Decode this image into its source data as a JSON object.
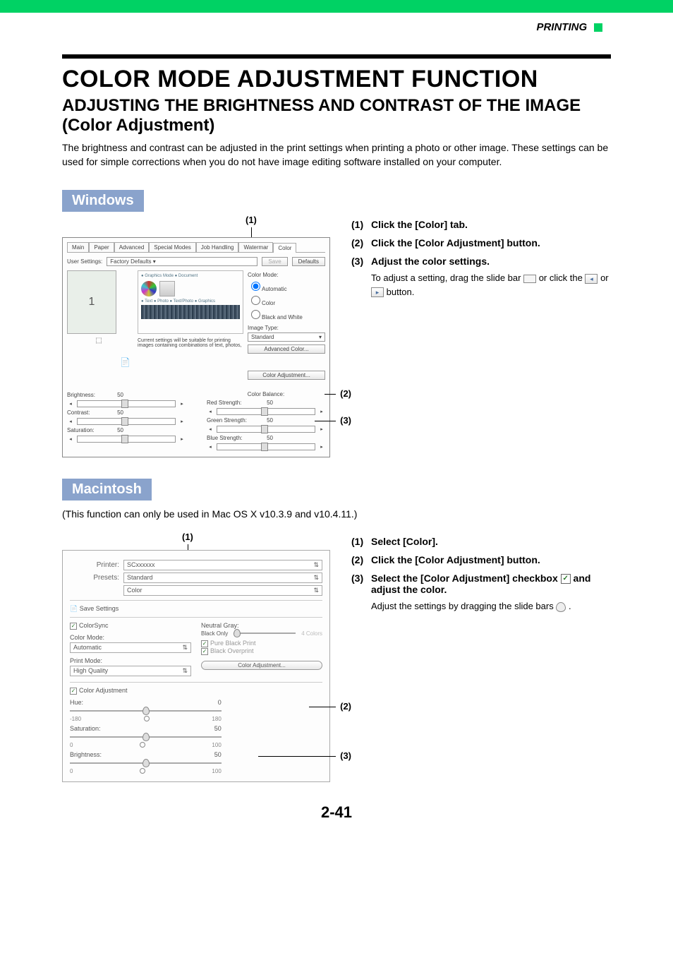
{
  "header": {
    "section": "PRINTING"
  },
  "titles": {
    "h1": "COLOR MODE ADJUSTMENT FUNCTION",
    "h2": "ADJUSTING THE BRIGHTNESS AND CONTRAST OF THE IMAGE (Color Adjustment)"
  },
  "intro": "The brightness and contrast can be adjusted in the print settings when printing a photo or other image. These settings can be used for simple corrections when you do not have image editing software installed on your computer.",
  "windows": {
    "badge": "Windows",
    "callouts": {
      "c1": "(1)",
      "c2": "(2)",
      "c3": "(3)"
    },
    "dialog": {
      "tabs": [
        "Main",
        "Paper",
        "Advanced",
        "Special Modes",
        "Job Handling",
        "Watermar",
        "Color"
      ],
      "user_settings_label": "User Settings:",
      "user_settings_value": "Factory Defaults",
      "save_btn": "Save",
      "defaults_btn": "Defaults",
      "preview_page": "1",
      "current_settings_text": "Current settings will be suitable for printing images containing combinations of text, photos,",
      "color_mode_label": "Color Mode:",
      "color_mode_options": [
        "Automatic",
        "Color",
        "Black and White"
      ],
      "image_type_label": "Image Type:",
      "image_type_value": "Standard",
      "advanced_color_btn": "Advanced Color...",
      "color_adjustment_btn": "Color Adjustment...",
      "color_balance_label": "Color Balance:",
      "sliders_left": [
        {
          "label": "Brightness:",
          "value": "50"
        },
        {
          "label": "Contrast:",
          "value": "50"
        },
        {
          "label": "Saturation:",
          "value": "50"
        }
      ],
      "sliders_right": [
        {
          "label": "Red Strength:",
          "value": "50"
        },
        {
          "label": "Green Strength:",
          "value": "50"
        },
        {
          "label": "Blue Strength:",
          "value": "50"
        }
      ]
    },
    "steps": [
      {
        "num": "(1)",
        "text": "Click the [Color] tab."
      },
      {
        "num": "(2)",
        "text": "Click the [Color Adjustment] button."
      },
      {
        "num": "(3)",
        "text": "Adjust the color settings.",
        "sub_a": "To adjust a setting, drag the slide bar ",
        "sub_b": " or click the ",
        "sub_c": " or ",
        "sub_d": " button."
      }
    ]
  },
  "macintosh": {
    "badge": "Macintosh",
    "note": "(This function can only be used in Mac OS X v10.3.9 and v10.4.11.)",
    "callouts": {
      "c1": "(1)",
      "c2": "(2)",
      "c3": "(3)"
    },
    "dialog": {
      "printer_label": "Printer:",
      "printer_value": "SCxxxxxx",
      "presets_label": "Presets:",
      "presets_value": "Standard",
      "pane_value": "Color",
      "save_settings": "Save Settings",
      "colorsync": "ColorSync",
      "color_mode_label": "Color Mode:",
      "color_mode_value": "Automatic",
      "print_mode_label": "Print Mode:",
      "print_mode_value": "High Quality",
      "neutral_gray_label": "Neutral Gray:",
      "neutral_black": "Black Only",
      "neutral_4c": "4 Colors",
      "pure_black": "Pure Black Print",
      "black_overprint": "Black Overprint",
      "color_adjustment_btn": "Color Adjustment...",
      "color_adjustment_cb": "Color Adjustment",
      "hue_label": "Hue:",
      "hue_value": "0",
      "hue_min": "-180",
      "hue_max": "180",
      "sat_label": "Saturation:",
      "sat_value": "50",
      "sat_min": "0",
      "sat_max": "100",
      "bri_label": "Brightness:",
      "bri_value": "50",
      "bri_min": "0",
      "bri_max": "100"
    },
    "steps": [
      {
        "num": "(1)",
        "text": "Select [Color]."
      },
      {
        "num": "(2)",
        "text": "Click the [Color Adjustment] button."
      },
      {
        "num": "(3)",
        "text": "Select the [Color Adjustment] checkbox ",
        "text_after": " and adjust the color.",
        "sub": "Adjust the settings by dragging the slide bars "
      }
    ]
  },
  "footer": "2-41"
}
